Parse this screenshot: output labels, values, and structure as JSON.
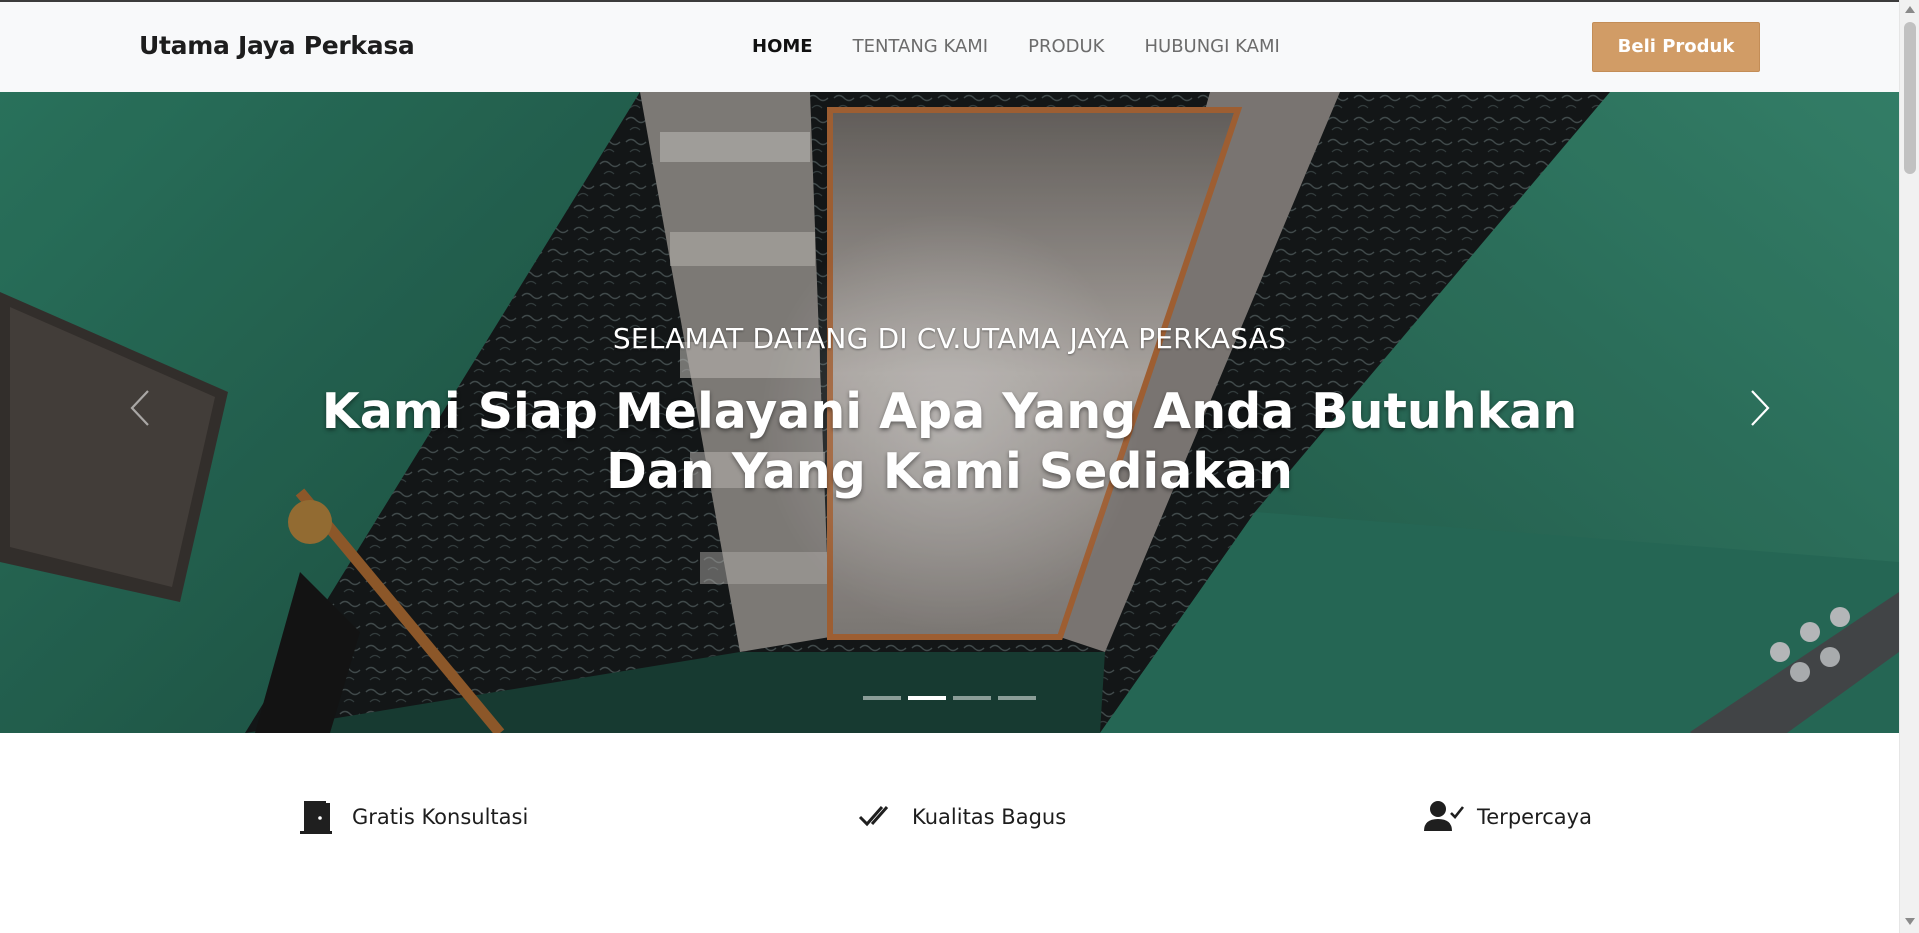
{
  "navbar": {
    "brand": "Utama Jaya Perkasa",
    "links": [
      {
        "label": "HOME",
        "active": true
      },
      {
        "label": "TENTANG KAMI",
        "active": false
      },
      {
        "label": "PRODUK",
        "active": false
      },
      {
        "label": "HUBUNGI KAMI",
        "active": false
      }
    ],
    "cta_label": "Beli Produk"
  },
  "hero": {
    "welcome": "SELAMAT DATANG DI CV.UTAMA JAYA PERKASAS",
    "headline": "Kami Siap Melayani Apa Yang Anda Butuhkan Dan Yang Kami Sediakan",
    "prev_icon": "chevron-left-icon",
    "next_icon": "chevron-right-icon",
    "slide_count": 4,
    "active_slide": 2
  },
  "features": [
    {
      "icon": "door-icon",
      "label": "Gratis Konsultasi"
    },
    {
      "icon": "double-check-icon",
      "label": "Kualitas Bagus"
    },
    {
      "icon": "user-check-icon",
      "label": "Terpercaya"
    }
  ],
  "colors": {
    "accent": "#d19c66",
    "navbar_bg": "#f8f9fa",
    "wall_green": "#2e7a63"
  }
}
